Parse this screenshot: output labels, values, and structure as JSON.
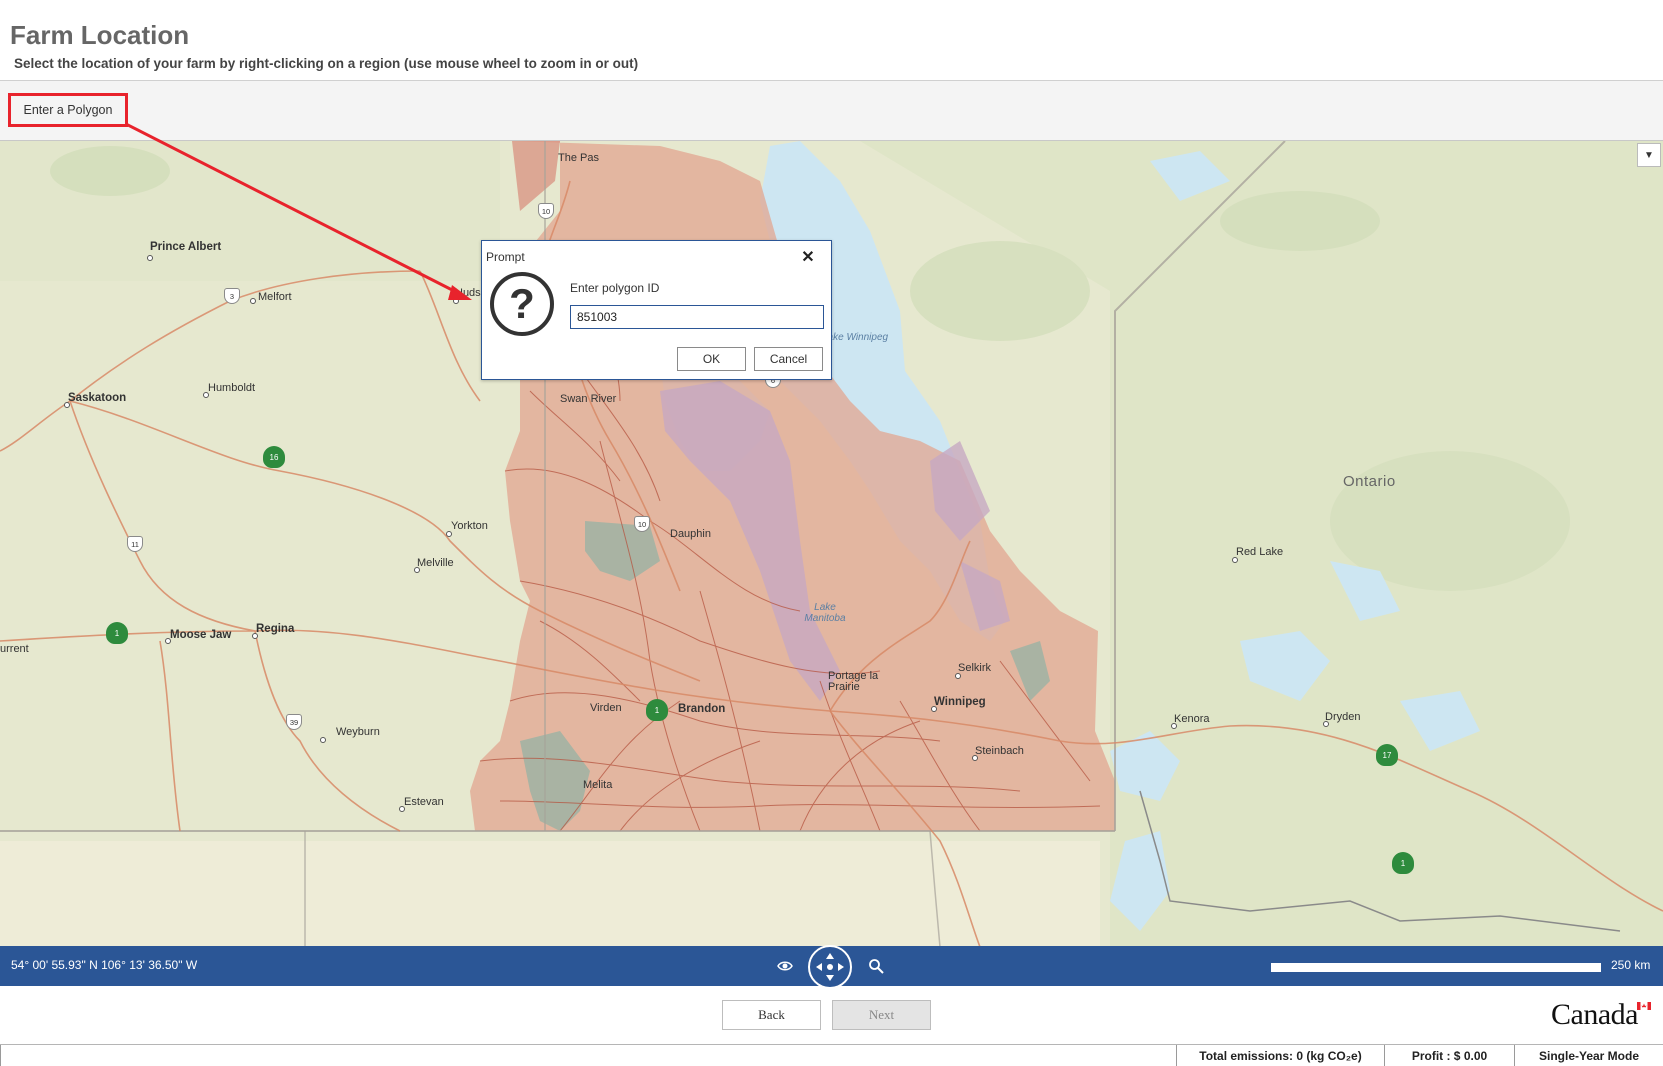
{
  "header": {
    "title": "Farm Location",
    "subtitle": "Select the location of your farm by right-clicking on a region (use mouse wheel to zoom in or out)"
  },
  "toolbar": {
    "enter_polygon_label": "Enter a Polygon"
  },
  "map": {
    "layer_toggle_glyph": "▼",
    "province_label": "Ontario",
    "water_labels": {
      "lake_winnipeg": "Lake Winnipeg",
      "lake_manitoba": "Lake Manitoba"
    },
    "cities": {
      "the_pas": "The Pas",
      "prince_albert": "Prince Albert",
      "melfort": "Melfort",
      "hudson": "Huds",
      "saskatoon": "Saskatoon",
      "humboldt": "Humboldt",
      "swan_river": "Swan River",
      "yorkton": "Yorkton",
      "melville": "Melville",
      "dauphin": "Dauphin",
      "red_lake": "Red Lake",
      "regina": "Regina",
      "moose_jaw": "Moose Jaw",
      "current": "urrent",
      "selkirk": "Selkirk",
      "portage": "Portage la Prairie",
      "winnipeg": "Winnipeg",
      "virden": "Virden",
      "brandon": "Brandon",
      "weyburn": "Weyburn",
      "steinbach": "Steinbach",
      "kenora": "Kenora",
      "dryden": "Dryden",
      "melita": "Melita",
      "estevan": "Estevan"
    },
    "highways": {
      "h10a": "10",
      "h3": "3",
      "h6": "6",
      "h16": "16",
      "h10b": "10",
      "h11": "11",
      "h39": "39",
      "h1a": "1",
      "h1b": "1",
      "h1c": "1",
      "h17": "17"
    },
    "status": {
      "coordinates": "54° 00' 55.93\" N 106° 13' 36.50\" W",
      "scale_label": "250 km"
    }
  },
  "dialog": {
    "title": "Prompt",
    "close_glyph": "✕",
    "question_glyph": "?",
    "prompt_label": "Enter polygon ID",
    "input_value": "851003",
    "ok_label": "OK",
    "cancel_label": "Cancel"
  },
  "navigation": {
    "back_label": "Back",
    "next_label": "Next",
    "brand_wordmark": "Canada"
  },
  "footer": {
    "emissions": "Total emissions: 0 (kg CO₂e)",
    "profit": "Profit :  $ 0.00",
    "mode": "Single-Year Mode"
  },
  "colors": {
    "accent_blue": "#2b5696",
    "annotation_red": "#e8232c",
    "polygon_fill": "#e2a590",
    "water": "#cde6f2"
  }
}
